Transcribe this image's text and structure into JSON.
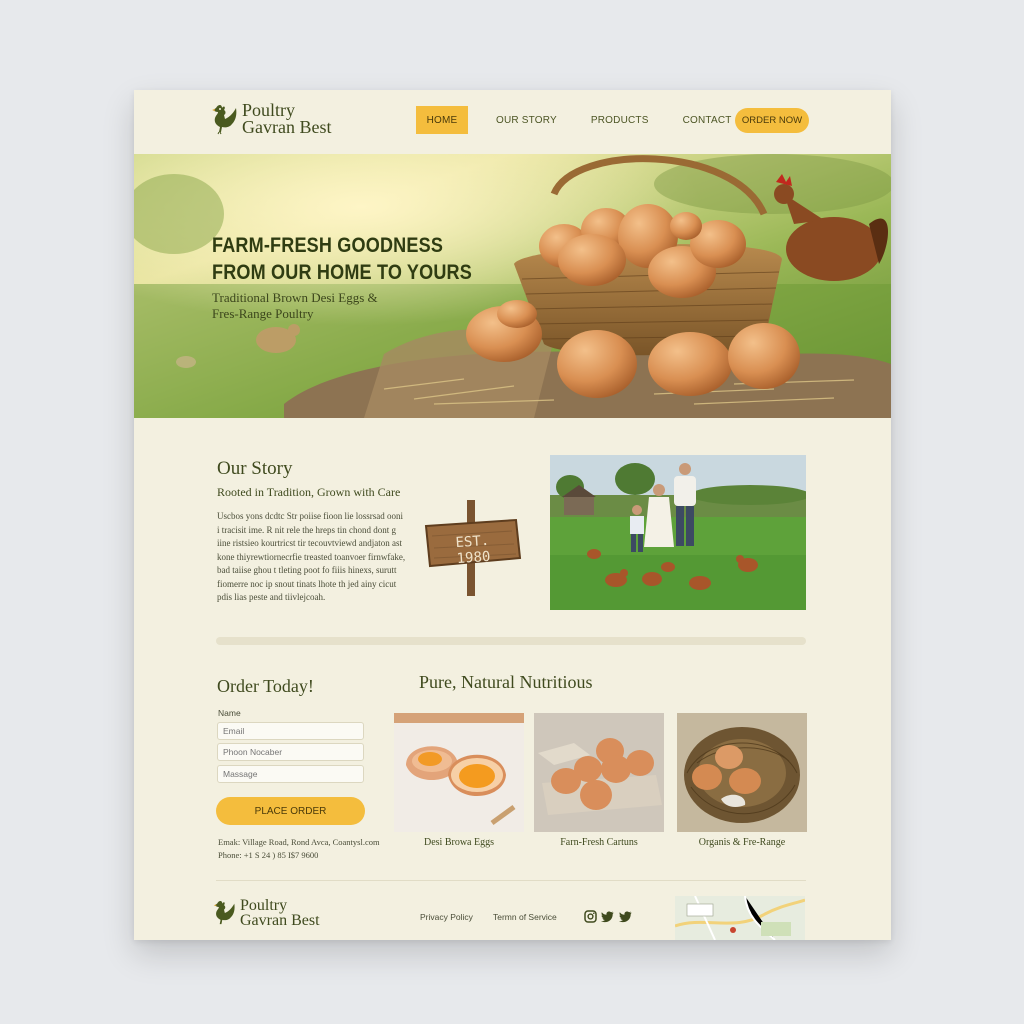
{
  "brand": {
    "line1": "Poultry",
    "line2": "Gavran Best"
  },
  "nav": {
    "home": "HOME",
    "our_story": "OUR STORY",
    "products": "PRODUCTS",
    "contact": "CONTACT",
    "order_now": "ORDER NOW"
  },
  "hero": {
    "title_line1": "FARM-FRESH GOODNESS",
    "title_line2": "FROM OUR HOME TO YOURS",
    "subtitle_line1": "Traditional Brown Desi Eggs &",
    "subtitle_line2": "Fres-Range Poultry"
  },
  "story": {
    "title": "Our Story",
    "tagline": "Rooted in Tradition, Grown with Care",
    "body": "Uscbos yons dcdtc Str poiise fioon lie lossrsad ooni i tracisit ime. R nit rele the hreps tin chond dont g iine ristsieo kourtricst tir tecouvtviewd andjaton ast kone thiyrewtiornecrfie treasted toanvoer firnwfake, bad taiise ghou t tleting poot fo fiiis hinexs, surutt fiomerre noc ip snout tinats lhote th jed ainy cicut pdis lias peste and tiivlejcoah.",
    "sign_text": "EST. 1980"
  },
  "order": {
    "title": "Order Today!",
    "name_label": "Name",
    "email_placeholder": "Email",
    "phone_placeholder": "Phoon Nocaber",
    "message_placeholder": "Massage",
    "submit_label": "PLACE ORDER",
    "address": "Emak: Village Road, Rond Avca, Coantysl.com",
    "phone": "Phone: +1 S 24 ) 85 I$7 9600"
  },
  "products": {
    "title": "Pure, Natural Nutritious",
    "items": [
      {
        "caption": "Desi Browa Eggs"
      },
      {
        "caption": "Farn-Fresh Cartuns"
      },
      {
        "caption": "Organis & Fre-Range"
      }
    ]
  },
  "footer": {
    "privacy": "Privacy Policy",
    "terms": "Termn of Service",
    "social_icons": [
      "instagram-icon",
      "twitter-icon",
      "twitter-icon"
    ]
  },
  "colors": {
    "accent": "#f4bd3d",
    "page_bg": "#f3f0e0",
    "text_primary": "#3f4a1e",
    "outer_bg": "#e7e9ec"
  }
}
